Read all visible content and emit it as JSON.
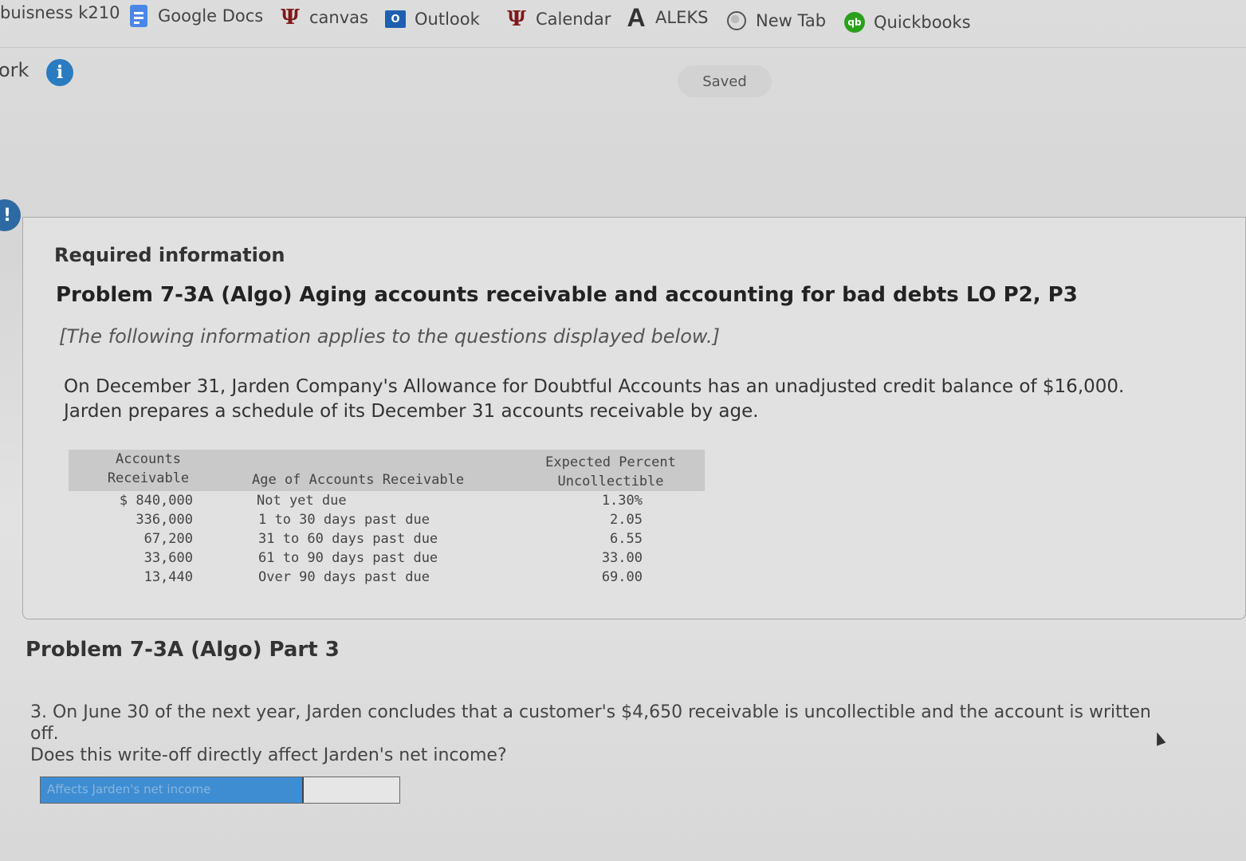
{
  "bookmarks": {
    "folder_label": "buisness k210",
    "items": [
      {
        "label": "Google Docs",
        "icon": "google-docs-icon"
      },
      {
        "label": "canvas",
        "icon": "iu-trident-icon",
        "glyph": "Ψ"
      },
      {
        "label": "Outlook",
        "icon": "outlook-icon",
        "glyph": "O"
      },
      {
        "label": "Calendar",
        "icon": "iu-trident-icon",
        "glyph": "Ψ"
      },
      {
        "label": "ALEKS",
        "icon": "aleks-icon",
        "glyph": "A"
      },
      {
        "label": "New Tab",
        "icon": "globe-icon"
      },
      {
        "label": "Quickbooks",
        "icon": "quickbooks-icon",
        "glyph": "qb"
      }
    ]
  },
  "header": {
    "work_label": "ork",
    "info_glyph": "i",
    "saved_label": "Saved",
    "alert_glyph": "!"
  },
  "info": {
    "required_label": "Required information",
    "problem_title": "Problem 7-3A (Algo) Aging accounts receivable and accounting for bad debts LO P2, P3",
    "applies_note": "[The following information applies to the questions displayed below.]",
    "intro_line1": "On December 31, Jarden Company's Allowance for Doubtful Accounts has an unadjusted credit balance of $16,000.",
    "intro_line2": "Jarden prepares a schedule of its December 31 accounts receivable by age."
  },
  "aging_table": {
    "headers": {
      "ar_line1": "Accounts",
      "ar_line2": "Receivable",
      "age": "Age of Accounts Receivable",
      "pct_line1": "Expected Percent",
      "pct_line2": "Uncollectible"
    },
    "rows": [
      {
        "ar": "$ 840,000",
        "age": "Not yet due",
        "pct": "1.30%"
      },
      {
        "ar": "336,000",
        "age": "1 to 30 days past due",
        "pct": "2.05"
      },
      {
        "ar": "67,200",
        "age": "31 to 60 days past due",
        "pct": "6.55"
      },
      {
        "ar": "33,600",
        "age": "61 to 90 days past due",
        "pct": "33.00"
      },
      {
        "ar": "13,440",
        "age": "Over 90 days past due",
        "pct": "69.00"
      }
    ]
  },
  "part": {
    "title": "Problem 7-3A (Algo) Part 3",
    "question_line1": "3. On June 30 of the next year, Jarden concludes that a customer's $4,650 receivable is uncollectible and the account is written off.",
    "question_line2": "Does this write-off directly affect Jarden's net income?",
    "answer_select_label": "Affects Jarden's net income",
    "answer_value": ""
  }
}
